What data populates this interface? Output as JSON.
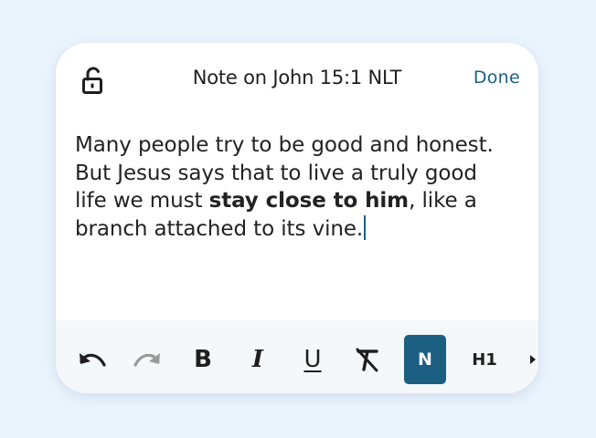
{
  "header": {
    "lock_icon": "unlocked-padlock-icon",
    "title": "Note on John 15:1 NLT",
    "done_label": "Done"
  },
  "note": {
    "text_before": "Many people try to be good and honest. But Jesus says that to live a truly good life we must ",
    "bold_text": "stay close to him",
    "text_after": ", like a branch attached to its vine."
  },
  "toolbar": {
    "undo_icon": "undo-icon",
    "redo_icon": "redo-icon",
    "bold_label": "B",
    "italic_label": "I",
    "underline_label": "U",
    "clear_format_icon": "clear-formatting-icon",
    "normal_label": "N",
    "h1_label": "H1",
    "more_icon": "triangle-right-icon"
  },
  "colors": {
    "accent": "#1c5f82",
    "background": "#eaf4fd",
    "card": "#ffffff",
    "toolbar": "#f5f8fb",
    "disabled": "#9a9a9a"
  }
}
